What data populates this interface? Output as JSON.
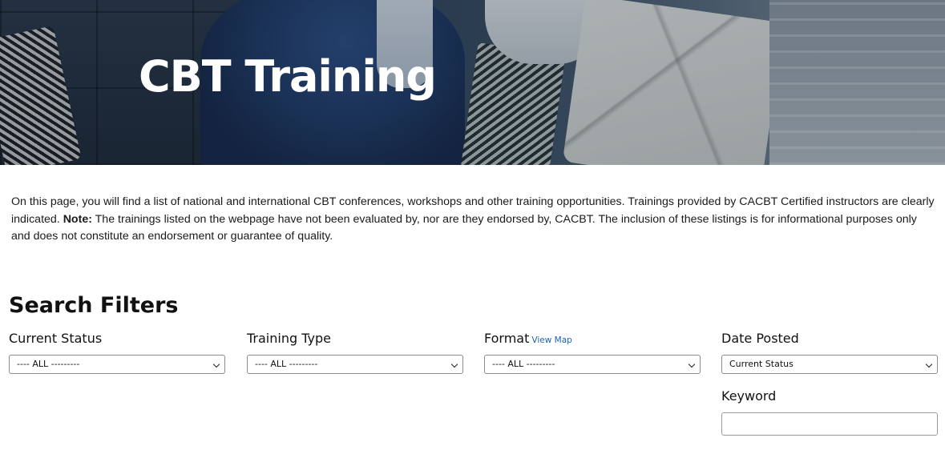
{
  "hero": {
    "title": "CBT Training"
  },
  "intro": {
    "text_before": "On this page, you will find a list of national and international CBT conferences, workshops and other training opportunities. Trainings provided by CACBT Certified instructors are clearly indicated. ",
    "note_label": "Note:",
    "text_after": " The trainings listed on the webpage have not been evaluated by, nor are they endorsed by, CACBT. The inclusion of these listings is for informational purposes only and does not constitute an endorsement or guarantee of quality."
  },
  "filters": {
    "heading": "Search Filters",
    "current_status": {
      "label": "Current Status",
      "value": "---- ALL ---------"
    },
    "training_type": {
      "label": "Training Type",
      "value": "---- ALL ---------"
    },
    "format": {
      "label": "Format",
      "link": "View Map",
      "value": "---- ALL ---------"
    },
    "date_posted": {
      "label": "Date Posted",
      "value": "Current Status"
    },
    "keyword": {
      "label": "Keyword",
      "value": "",
      "placeholder": ""
    }
  },
  "colors": {
    "link": "#1a62b0",
    "hero_text": "#ffffff"
  }
}
